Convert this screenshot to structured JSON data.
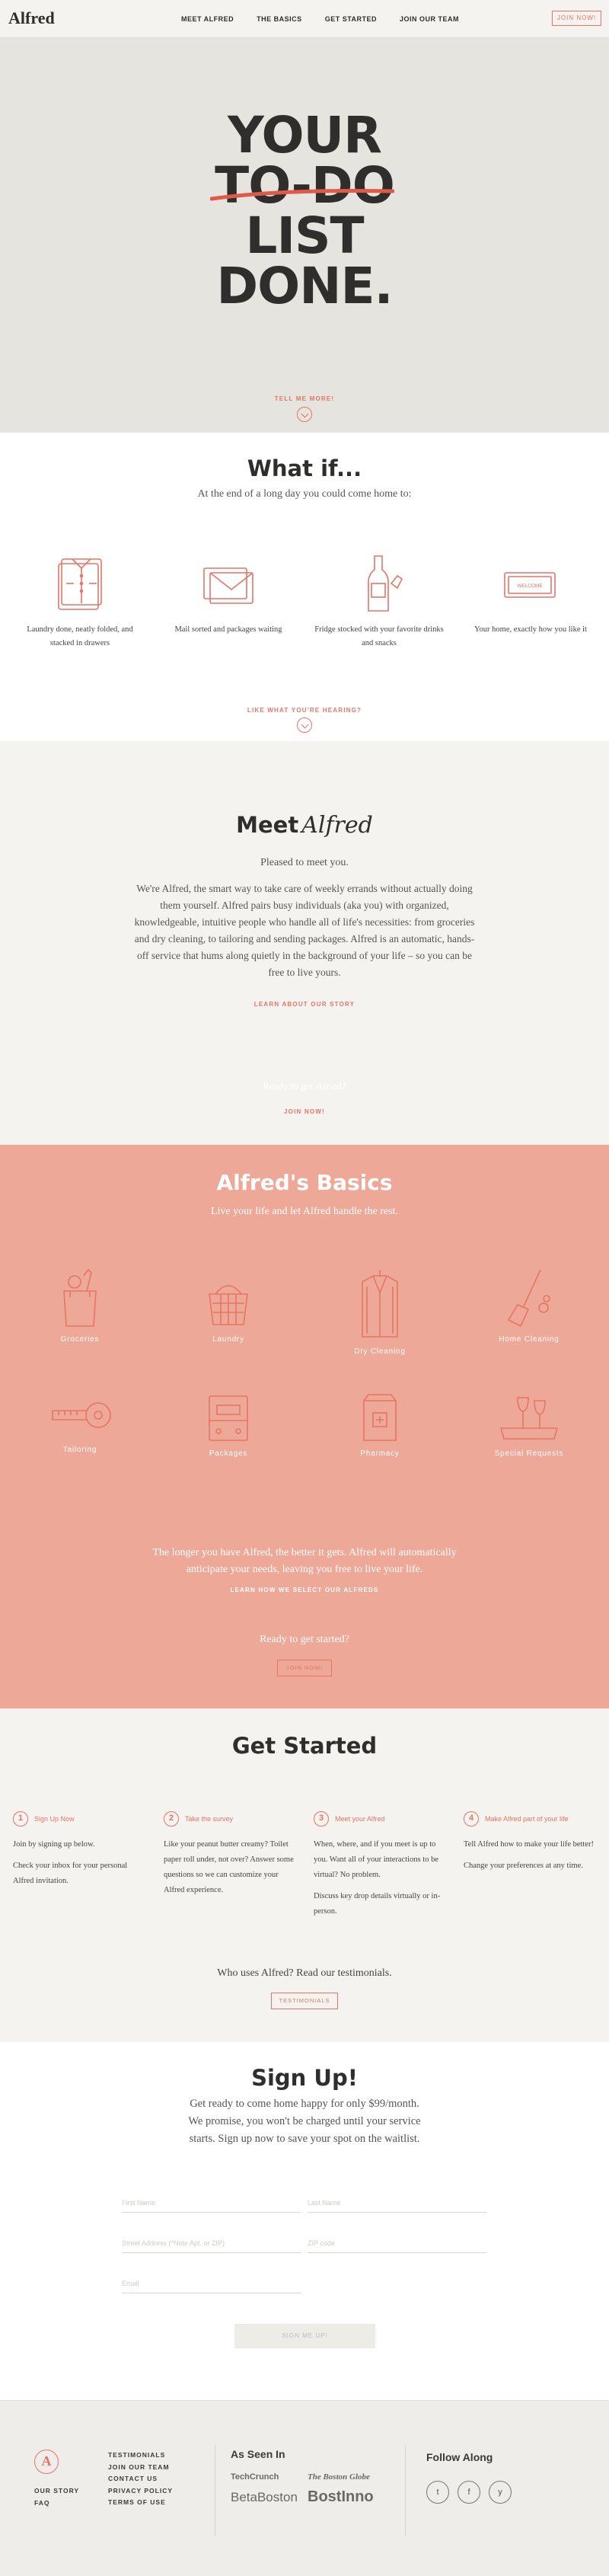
{
  "header": {
    "logo": "Alfred",
    "nav": [
      "MEET ALFRED",
      "THE BASICS",
      "GET STARTED",
      "JOIN OUR TEAM"
    ],
    "join_button": "JOIN NOW!"
  },
  "hero": {
    "line1": "YOUR",
    "line2": "TO-DO",
    "line3": "LIST",
    "line4": "DONE.",
    "tell_more": "TELL ME MORE!"
  },
  "what_if": {
    "title": "What if...",
    "subtitle": "At the end of a long day you could come home to:",
    "items": [
      {
        "icon": "laundry-shirts-icon",
        "caption": "Laundry done, neatly folded, and stacked in drawers"
      },
      {
        "icon": "mail-envelope-icon",
        "caption": "Mail sorted and packages waiting"
      },
      {
        "icon": "wine-bottle-icon",
        "caption": "Fridge stocked with your favorite drinks and snacks"
      },
      {
        "icon": "welcome-mat-icon",
        "caption": "Your home, exactly how you like it",
        "mat_text": "WELCOME"
      }
    ],
    "link": "LIKE WHAT YOU'RE HEARING?"
  },
  "meet": {
    "title_a": "Meet",
    "title_b": "Alfred",
    "pleased": "Pleased to meet you.",
    "body": "We're Alfred, the smart way to take care of weekly errands without actually doing them yourself. Alfred pairs busy individuals (aka you) with organized, knowledgeable, intuitive people who handle all of life's necessities: from groceries and dry cleaning, to tailoring and sending packages. Alfred is an automatic, hands-off service that hums along quietly in the background of your life – so you can be free to live yours.",
    "link": "LEARN ABOUT OUR STORY",
    "ready": "Ready to get started?",
    "join": "JOIN NOW!"
  },
  "basics": {
    "title": "Alfred's Basics",
    "subtitle": "Live your life and let Alfred handle the rest.",
    "items": [
      {
        "icon": "grocery-bag-icon",
        "label": "Groceries"
      },
      {
        "icon": "laundry-basket-icon",
        "label": "Laundry"
      },
      {
        "icon": "dry-cleaning-jacket-icon",
        "label": "Dry Cleaning"
      },
      {
        "icon": "broom-icon",
        "label": "Home Cleaning"
      },
      {
        "icon": "measuring-tape-icon",
        "label": "Tailoring"
      },
      {
        "icon": "package-icon",
        "label": "Packages"
      },
      {
        "icon": "pharmacy-bag-icon",
        "label": "Pharmacy"
      },
      {
        "icon": "wine-glasses-icon",
        "label": "Special Requests"
      }
    ],
    "longer": "The longer you have Alfred, the better it gets. Alfred will automatically anticipate your needs, leaving you free to live your life.",
    "link": "LEARN HOW WE SELECT OUR ALFREDS",
    "ready": "Ready to get started?",
    "join": "JOIN NOW!"
  },
  "get_started": {
    "title": "Get Started",
    "steps": [
      {
        "num": "1",
        "title": "Sign Up Now",
        "paras": [
          "Join by signing up below.",
          "Check your inbox for your personal Alfred invitation."
        ]
      },
      {
        "num": "2",
        "title": "Take the survey",
        "paras": [
          "Like your peanut butter creamy? Toilet paper roll under, not over? Answer some questions so we can customize your Alfred experience."
        ]
      },
      {
        "num": "3",
        "title": "Meet your Alfred",
        "paras": [
          "When, where, and if you meet is up to you. Want all of your interactions to be virtual? No problem.",
          "Discuss key drop details virtually or in-person."
        ]
      },
      {
        "num": "4",
        "title": "Make Alfred part of your life",
        "paras": [
          "Tell Alfred how to make your life better!",
          "Change your preferences at any time."
        ]
      }
    ],
    "who": "Who uses Alfred? Read our testimonials.",
    "testimonials": "TESTIMONIALS"
  },
  "signup": {
    "title": "Sign Up!",
    "body": "Get ready to come home happy for only $99/month. We promise, you won't be charged until your service starts. Sign up now to save your spot on the waitlist.",
    "first_name": "First Name",
    "last_name": "Last Name",
    "street": "Street Address (*Note Apt. or ZIP)",
    "zip": "ZIP code",
    "email": "Email",
    "button": "SIGN ME UP!"
  },
  "footer": {
    "logo_letter": "A",
    "col1": [
      "OUR STORY",
      "FAQ"
    ],
    "col2": [
      "TESTIMONIALS",
      "JOIN OUR TEAM",
      "CONTACT US",
      "PRIVACY POLICY",
      "TERMS OF USE"
    ],
    "as_seen": "As Seen In",
    "press": [
      "TechCrunch",
      "The Boston Globe",
      "BetaBoston",
      "BostInno"
    ],
    "follow": "Follow Along",
    "social": [
      "t",
      "f",
      "y"
    ]
  }
}
